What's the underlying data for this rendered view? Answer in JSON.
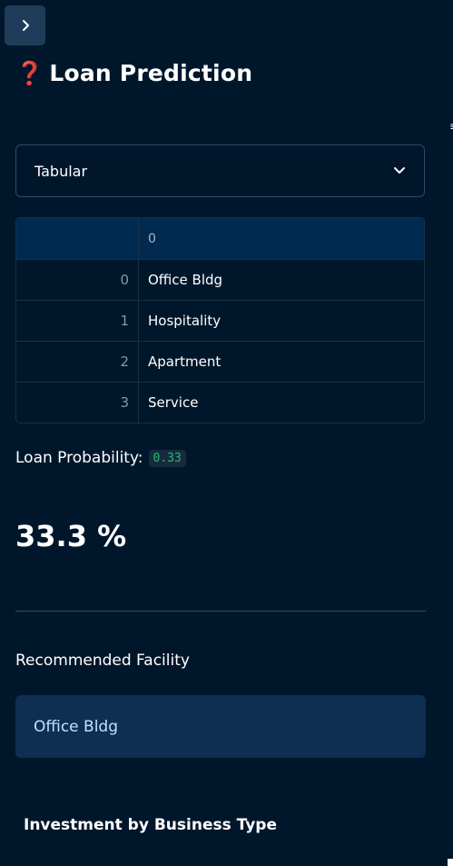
{
  "sidebar_toggle": {
    "icon": "chevron-right-icon",
    "glyph": "›"
  },
  "header": {
    "icon": "question-mark-icon",
    "glyph": "❓",
    "title": "Loan Prediction"
  },
  "select": {
    "value": "Tabular",
    "icon": "chevron-down-icon"
  },
  "table": {
    "columns": [
      "",
      "0"
    ],
    "rows": [
      {
        "index": "0",
        "value": "Office Bldg"
      },
      {
        "index": "1",
        "value": "Hospitality"
      },
      {
        "index": "2",
        "value": "Apartment"
      },
      {
        "index": "3",
        "value": "Service"
      }
    ]
  },
  "probability": {
    "label": "Loan Probability:",
    "value": "0.33"
  },
  "percent_text": "33.3 %",
  "recommendation": {
    "label": "Recommended Facility",
    "value": "Office Bldg"
  },
  "section_title": "Investment by Business Type",
  "colors": {
    "background": "#00172b",
    "accent_green": "#2bb673",
    "info_box": "#0e2f52"
  }
}
